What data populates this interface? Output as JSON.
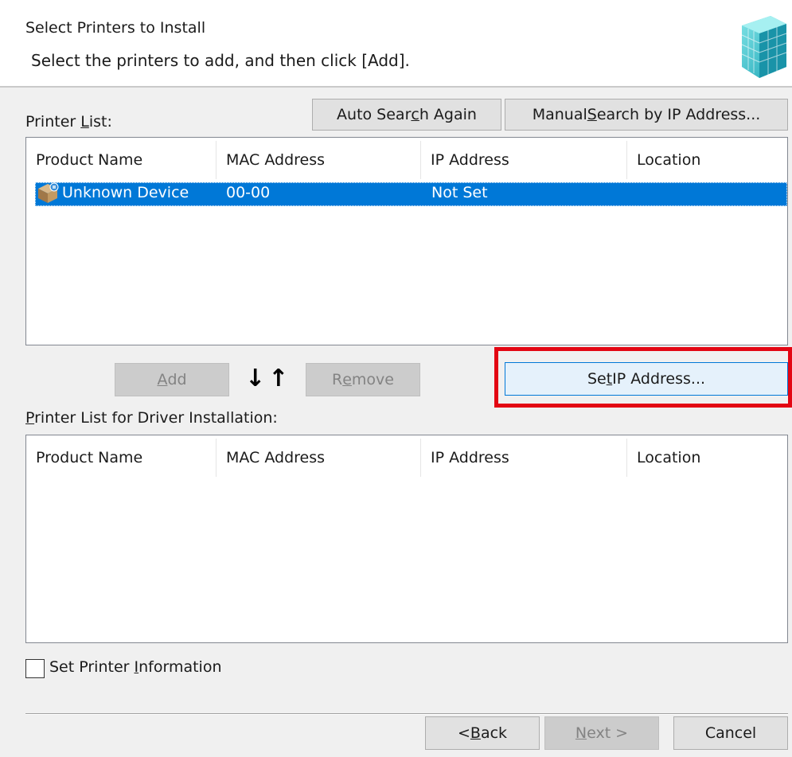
{
  "header": {
    "title": "Select Printers to Install",
    "subtitle": "Select the printers to add, and then click [Add]."
  },
  "printer_list": {
    "label_pre": "Printer ",
    "label_u": "L",
    "label_post": "ist:",
    "columns": [
      "Product Name",
      "MAC Address",
      "IP Address",
      "Location"
    ],
    "rows": [
      {
        "product_name": "Unknown Device",
        "mac_address": "00-00",
        "ip_address": "Not Set",
        "location": ""
      }
    ]
  },
  "toolbar": {
    "auto_search": {
      "pre": "Auto Sear",
      "u": "c",
      "post": "h Again"
    },
    "manual_search": {
      "pre": "Manual ",
      "u": "S",
      "post": "earch by IP Address..."
    }
  },
  "actions": {
    "add": {
      "pre": "",
      "u": "A",
      "post": "dd"
    },
    "arrows": "↓↑",
    "remove": {
      "pre": "R",
      "u": "e",
      "post": "move"
    },
    "set_ip": {
      "pre": "Se",
      "u": "t",
      "post": " IP Address..."
    }
  },
  "install_list": {
    "label_pre": "",
    "label_u": "P",
    "label_post": "rinter List for Driver Installation:",
    "columns": [
      "Product Name",
      "MAC Address",
      "IP Address",
      "Location"
    ]
  },
  "set_printer_info": {
    "pre": "Set Printer ",
    "u": "I",
    "post": "nformation",
    "checked": false
  },
  "nav": {
    "back": {
      "pre": "< ",
      "u": "B",
      "post": "ack"
    },
    "next": {
      "pre": "",
      "u": "N",
      "post": "ext >"
    },
    "cancel": "Cancel"
  },
  "colors": {
    "selection": "#0078d7",
    "highlight": "#e30613"
  }
}
